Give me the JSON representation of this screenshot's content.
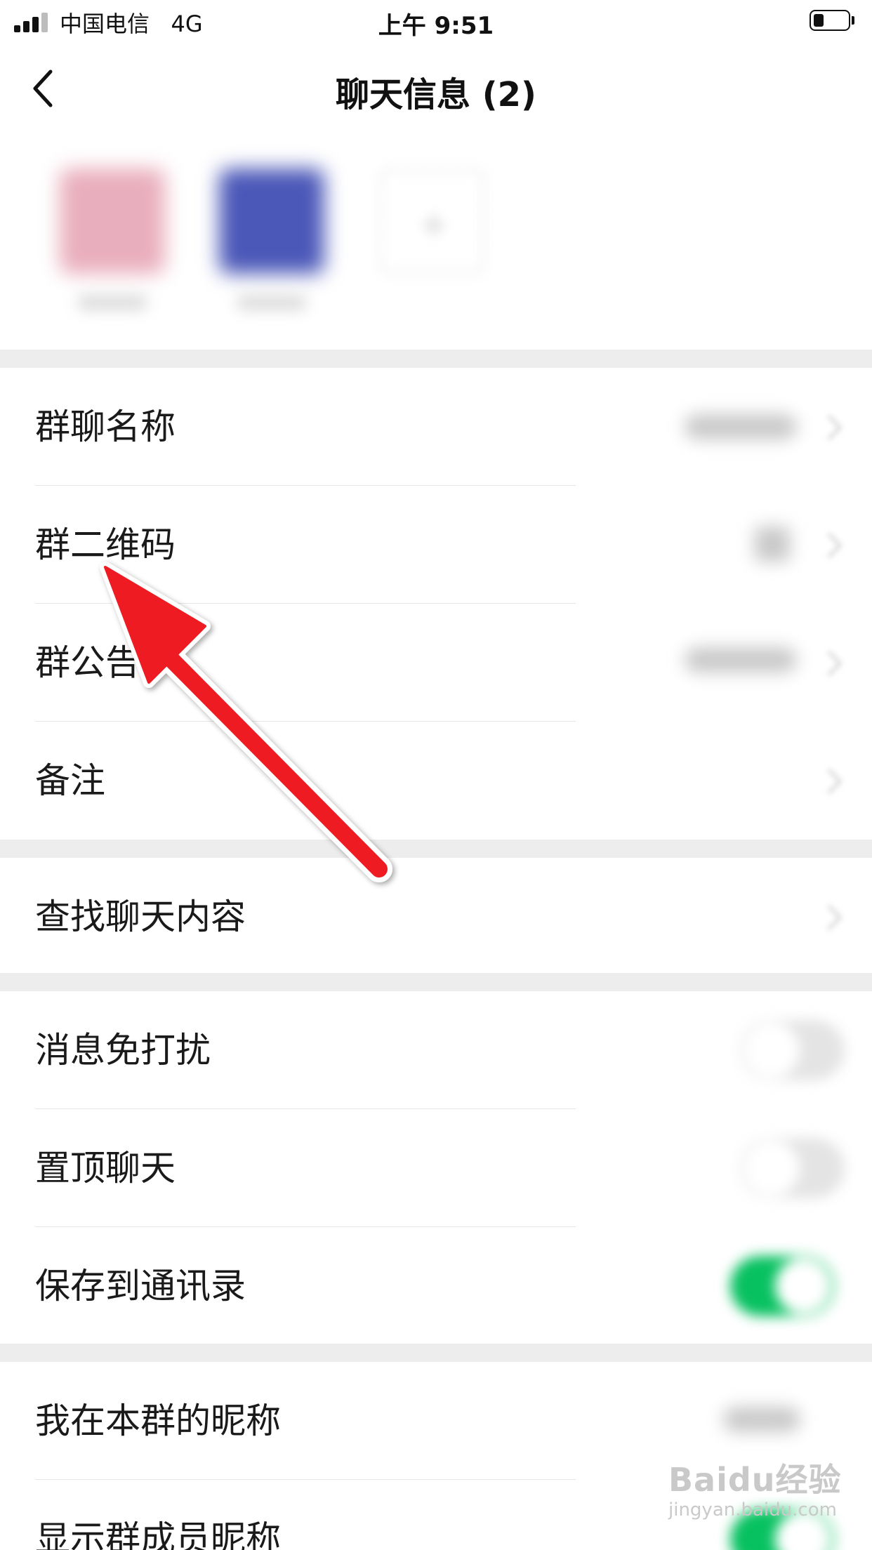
{
  "status_bar": {
    "carrier": "中国电信",
    "network": "4G",
    "time": "上午 9:51"
  },
  "nav": {
    "title": "聊天信息 (2)"
  },
  "members": {
    "add_symbol": "+"
  },
  "rows": {
    "group_name": "群聊名称",
    "group_qr": "群二维码",
    "group_notice": "群公告",
    "remark": "备注",
    "search_chat": "查找聊天内容",
    "mute": "消息免打扰",
    "pin_chat": "置顶聊天",
    "save_contacts": "保存到通讯录",
    "my_nickname": "我在本群的昵称",
    "show_nicknames": "显示群成员昵称"
  },
  "toggles": {
    "mute": false,
    "pin_chat": false,
    "save_contacts": true,
    "show_nicknames": true
  },
  "colors": {
    "toggle_on": "#07c160",
    "arrow": "#ee1c24"
  },
  "watermark": {
    "logo": "Baidu经验",
    "url": "jingyan.baidu.com"
  }
}
